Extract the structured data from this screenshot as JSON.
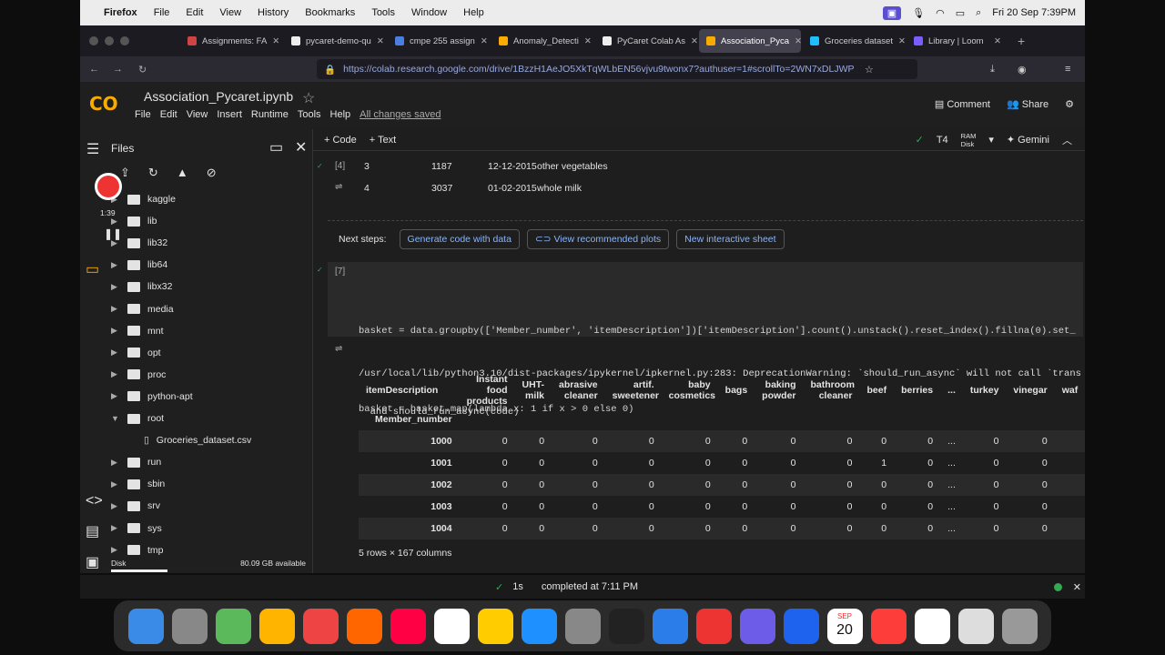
{
  "menubar": {
    "app": "Firefox",
    "items": [
      "File",
      "Edit",
      "View",
      "History",
      "Bookmarks",
      "Tools",
      "Window",
      "Help"
    ],
    "datetime": "Fri 20 Sep  7:39PM"
  },
  "tabs": [
    {
      "label": "Assignments: FA",
      "color": "#c44"
    },
    {
      "label": "pycaret-demo-qu",
      "color": "#eee"
    },
    {
      "label": "cmpe 255 assign",
      "color": "#4a7fe0"
    },
    {
      "label": "Anomaly_Detecti",
      "color": "#f9ab00"
    },
    {
      "label": "PyCaret Colab As",
      "color": "#eee"
    },
    {
      "label": "Association_Pyca",
      "color": "#f9ab00",
      "active": true
    },
    {
      "label": "Groceries dataset",
      "color": "#20beff"
    },
    {
      "label": "Library | Loom",
      "color": "#7a5cff"
    }
  ],
  "url": "https://colab.research.google.com/drive/1BzzH1AeJO5XkTqWLbEN56vjvu9twonx7?authuser=1#scrollTo=2WN7xDLJWP",
  "colab": {
    "logo": "CO",
    "title": "Association_Pycaret.ipynb",
    "menus": [
      "File",
      "Edit",
      "View",
      "Insert",
      "Runtime",
      "Tools",
      "Help"
    ],
    "saved": "All changes saved",
    "comment": "Comment",
    "share": "Share"
  },
  "toolbar": {
    "code": "+ Code",
    "text": "+ Text",
    "runtime": "T4",
    "ram": "RAM",
    "disk": "Disk",
    "gemini": "Gemini"
  },
  "sidebar": {
    "title": "Files",
    "folders": [
      "kaggle",
      "lib",
      "lib32",
      "lib64",
      "libx32",
      "media",
      "mnt",
      "opt",
      "proc",
      "python-apt",
      "root",
      "run",
      "sbin",
      "srv",
      "sys",
      "tmp"
    ],
    "file": "Groceries_dataset.csv",
    "disk_label": "Disk",
    "disk_free": "80.09 GB available",
    "rec_time": "1:39"
  },
  "prev_output": {
    "cell_label": "[4]",
    "rows": [
      [
        "3",
        "1187",
        "12-12-2015",
        "other vegetables"
      ],
      [
        "4",
        "3037",
        "01-02-2015",
        "whole milk"
      ]
    ]
  },
  "next_steps": {
    "label": "Next steps:",
    "buttons": [
      "Generate code with data",
      "View recommended plots",
      "New interactive sheet"
    ]
  },
  "cell7": {
    "label": "[7]",
    "lines": [
      "basket = data.groupby(['Member_number', 'itemDescription'])['itemDescription'].count().unstack().reset_index().fillna(0).set_",
      "basket = basket.map(lambda x: 1 if x > 0 else 0)",
      "basket.head()"
    ]
  },
  "warning": [
    "/usr/local/lib/python3.10/dist-packages/ipykernel/ipkernel.py:283: DeprecationWarning: `should_run_async` will not call `trans",
    "  and should_run_async(code)"
  ],
  "df": {
    "index_name": "itemDescription",
    "row_name": "Member_number",
    "columns": [
      "Instant food products",
      "UHT-milk",
      "abrasive cleaner",
      "artif. sweetener",
      "baby cosmetics",
      "bags",
      "baking powder",
      "bathroom cleaner",
      "beef",
      "berries",
      "...",
      "turkey",
      "vinegar",
      "waf"
    ],
    "rows": [
      {
        "idx": "1000",
        "vals": [
          "0",
          "0",
          "0",
          "0",
          "0",
          "0",
          "0",
          "0",
          "0",
          "0",
          "...",
          "0",
          "0",
          ""
        ]
      },
      {
        "idx": "1001",
        "vals": [
          "0",
          "0",
          "0",
          "0",
          "0",
          "0",
          "0",
          "0",
          "1",
          "0",
          "...",
          "0",
          "0",
          ""
        ]
      },
      {
        "idx": "1002",
        "vals": [
          "0",
          "0",
          "0",
          "0",
          "0",
          "0",
          "0",
          "0",
          "0",
          "0",
          "...",
          "0",
          "0",
          ""
        ]
      },
      {
        "idx": "1003",
        "vals": [
          "0",
          "0",
          "0",
          "0",
          "0",
          "0",
          "0",
          "0",
          "0",
          "0",
          "...",
          "0",
          "0",
          ""
        ]
      },
      {
        "idx": "1004",
        "vals": [
          "0",
          "0",
          "0",
          "0",
          "0",
          "0",
          "0",
          "0",
          "0",
          "0",
          "...",
          "0",
          "0",
          ""
        ]
      }
    ],
    "shape": "5 rows × 167 columns"
  },
  "status": {
    "elapsed": "1s",
    "completed": "completed at 7:11 PM"
  },
  "dock": [
    "#3a8be8",
    "#888",
    "#5bb85b",
    "#ffb400",
    "#e44",
    "#f60",
    "#f04",
    "#fff",
    "#fc0",
    "#1e90ff",
    "#888",
    "#222",
    "#2b7de9",
    "#e33",
    "#6c5ce7",
    "#1d63ed",
    "#fc3d39",
    "#fff",
    "#ddd",
    "#999"
  ],
  "dock_date": {
    "month": "SEP",
    "day": "20"
  }
}
